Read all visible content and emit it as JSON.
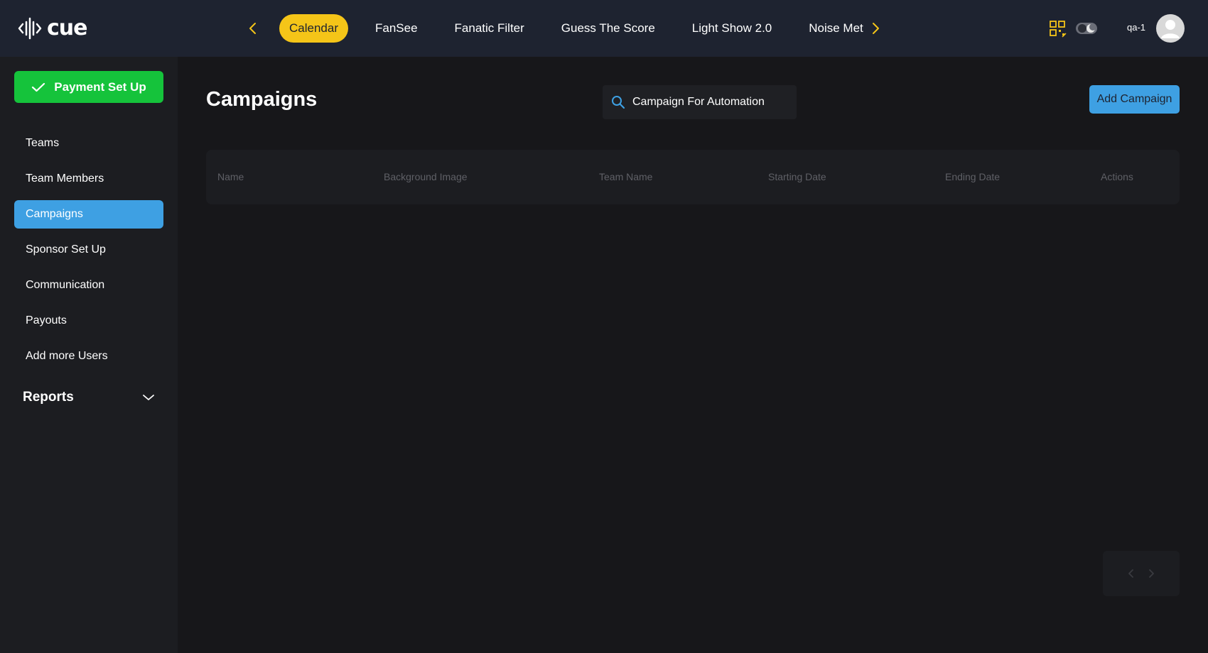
{
  "app": {
    "logo_text": "cue"
  },
  "nav": {
    "tabs": [
      {
        "label": "Calendar",
        "active": true
      },
      {
        "label": "FanSee"
      },
      {
        "label": "Fanatic Filter"
      },
      {
        "label": "Guess The Score"
      },
      {
        "label": "Light Show 2.0"
      },
      {
        "label": "Noise Met"
      }
    ],
    "prev_icon": "chevron-left-icon",
    "next_icon": "chevron-right-icon"
  },
  "user": {
    "name": "qa-1"
  },
  "sidebar": {
    "payment_button": "Payment Set Up",
    "items": [
      {
        "label": "Teams"
      },
      {
        "label": "Team Members"
      },
      {
        "label": "Campaigns",
        "active": true
      },
      {
        "label": "Sponsor Set Up"
      },
      {
        "label": "Communication"
      },
      {
        "label": "Payouts"
      },
      {
        "label": "Add more Users"
      }
    ],
    "reports_label": "Reports"
  },
  "main": {
    "title": "Campaigns",
    "search": {
      "value": "Campaign For Automation",
      "placeholder": ""
    },
    "add_button": "Add Campaign",
    "table": {
      "columns": [
        "Name",
        "Background Image",
        "Team Name",
        "Starting Date",
        "Ending Date",
        "Actions"
      ],
      "rows": []
    }
  },
  "colors": {
    "accent_yellow": "#f5c518",
    "accent_blue": "#3ea0e3",
    "success_green": "#15c33b",
    "topbar_bg": "#1e2330",
    "page_bg": "#17171a"
  }
}
